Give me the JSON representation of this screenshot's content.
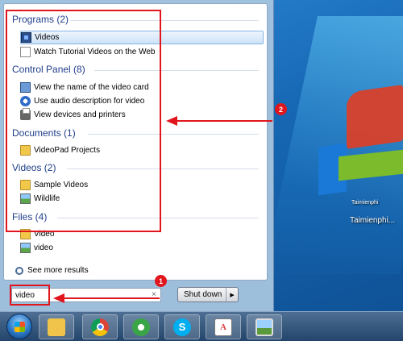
{
  "search": {
    "value": "video",
    "clear_glyph": "×"
  },
  "results": {
    "categories": [
      {
        "label": "Programs (2)",
        "items": [
          {
            "label": "Videos",
            "icon": "video-library-icon",
            "selected": true
          },
          {
            "label": "Watch Tutorial Videos on the Web",
            "icon": "document-icon"
          }
        ]
      },
      {
        "label": "Control Panel (8)",
        "items": [
          {
            "label": "View the name of the video card",
            "icon": "monitor-icon"
          },
          {
            "label": "Use audio description for video",
            "icon": "ease-of-access-icon"
          },
          {
            "label": "View devices and printers",
            "icon": "printer-icon"
          }
        ]
      },
      {
        "label": "Documents (1)",
        "items": [
          {
            "label": "VideoPad Projects",
            "icon": "folder-icon"
          }
        ]
      },
      {
        "label": "Videos (2)",
        "items": [
          {
            "label": "Sample Videos",
            "icon": "folder-icon"
          },
          {
            "label": "Wildlife",
            "icon": "video-file-icon"
          }
        ]
      },
      {
        "label": "Files (4)",
        "items": [
          {
            "label": "Video",
            "icon": "folder-icon"
          },
          {
            "label": "video",
            "icon": "video-file-icon"
          }
        ]
      }
    ],
    "see_more": "See more results"
  },
  "shutdown": {
    "label": "Shut down",
    "arrow": "▶"
  },
  "annotations": {
    "badge_1": "1",
    "badge_2": "2",
    "color": "#e0161c"
  },
  "desktop": {
    "watermark_small": "Taimienphi",
    "watermark_main": "Taimienphi..."
  },
  "taskbar": {
    "skype_glyph": "S",
    "word_glyph": "A"
  }
}
